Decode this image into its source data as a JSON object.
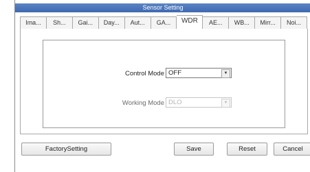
{
  "window": {
    "title": "Sensor Setting"
  },
  "tabs": [
    {
      "label": "Ima..."
    },
    {
      "label": "Sh..."
    },
    {
      "label": "Gai..."
    },
    {
      "label": "Day..."
    },
    {
      "label": "Aut..."
    },
    {
      "label": "GA..."
    },
    {
      "label": "WDR",
      "active": true
    },
    {
      "label": "AE..."
    },
    {
      "label": "WB..."
    },
    {
      "label": "Mirr..."
    },
    {
      "label": "Noi..."
    }
  ],
  "wdr": {
    "control_mode_label": "Control Mode",
    "control_mode_value": "OFF",
    "working_mode_label": "Working Mode",
    "working_mode_value": "DLO"
  },
  "buttons": {
    "factory": "FactorySetting",
    "save": "Save",
    "reset": "Reset",
    "cancel": "Cancel"
  }
}
